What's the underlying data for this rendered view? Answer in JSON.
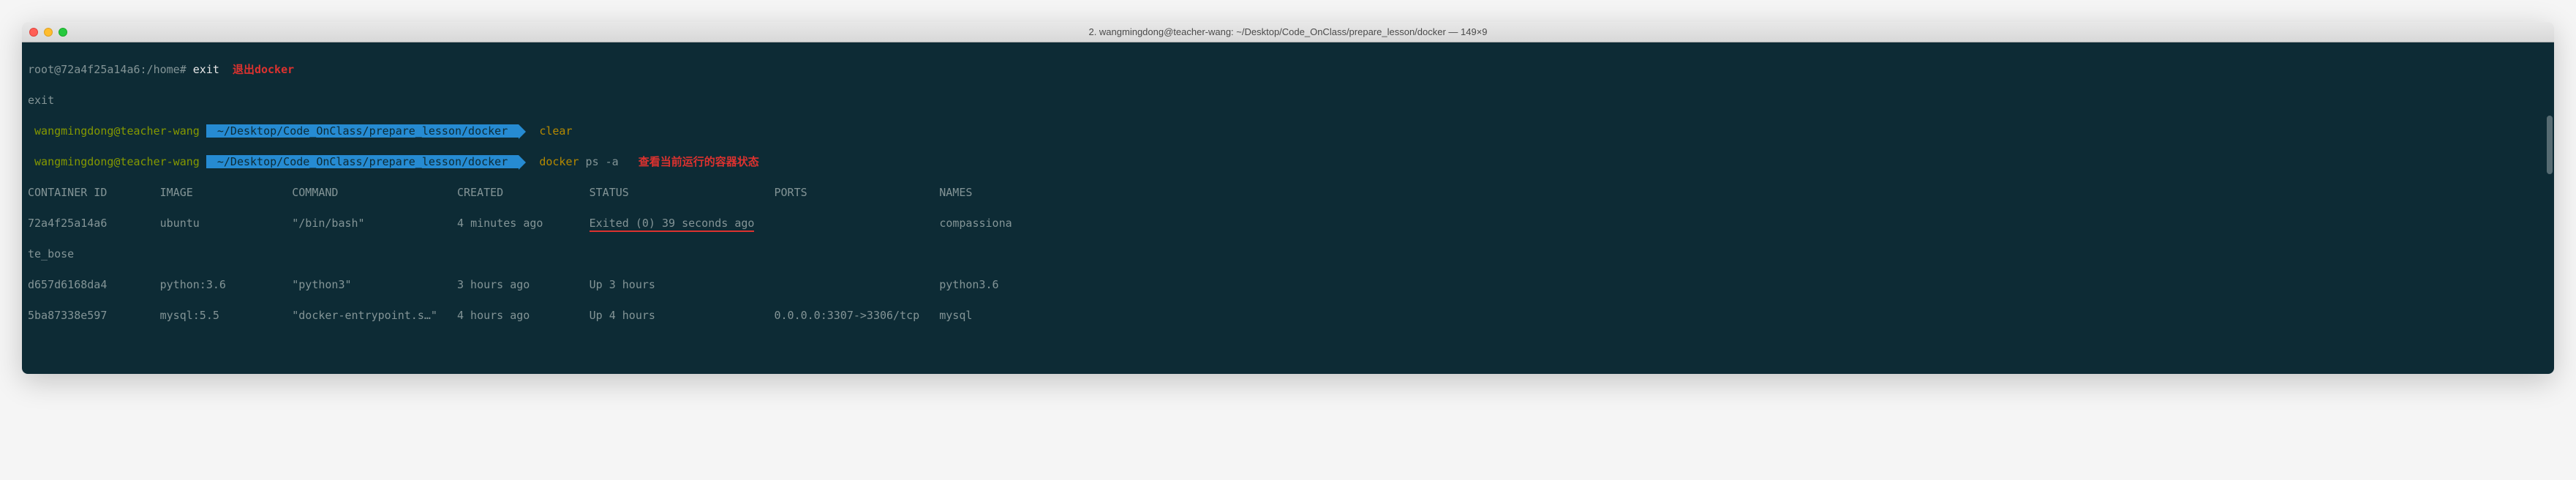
{
  "window": {
    "title": "2. wangmingdong@teacher-wang: ~/Desktop/Code_OnClass/prepare_lesson/docker — 149×9"
  },
  "lines": {
    "l1_prompt": "root@72a4f25a14a6:/home# ",
    "l1_cmd": "exit",
    "l1_anno": "  退出docker",
    "l2": "exit",
    "l3_user": " wangmingdong@teacher-wang ",
    "l3_path": " ~/Desktop/Code_OnClass/prepare_lesson/docker ",
    "l3_cmd": "  clear",
    "l4_user": " wangmingdong@teacher-wang ",
    "l4_path": " ~/Desktop/Code_OnClass/prepare_lesson/docker ",
    "l4_cmd1": "  docker",
    "l4_cmd2": " ps -a",
    "l4_anno": "   查看当前运行的容器状态"
  },
  "table": {
    "headers": {
      "c1": "CONTAINER ID",
      "c2": "IMAGE",
      "c3": "COMMAND",
      "c4": "CREATED",
      "c5": "STATUS",
      "c6": "PORTS",
      "c7": "NAMES"
    },
    "rows": [
      {
        "id": "72a4f25a14a6",
        "image": "ubuntu",
        "command": "\"/bin/bash\"",
        "created": "4 minutes ago",
        "status": "Exited (0) 39 seconds ago",
        "ports": "",
        "names": "compassionate_bose"
      },
      {
        "id": "d657d6168da4",
        "image": "python:3.6",
        "command": "\"python3\"",
        "created": "3 hours ago",
        "status": "Up 3 hours",
        "ports": "",
        "names": "python3.6"
      },
      {
        "id": "5ba87338e597",
        "image": "mysql:5.5",
        "command": "\"docker-entrypoint.s…\"",
        "created": "4 hours ago",
        "status": "Up 4 hours",
        "ports": "0.0.0.0:3307->3306/tcp",
        "names": "mysql"
      }
    ]
  },
  "formatted": {
    "header": "CONTAINER ID        IMAGE               COMMAND                  CREATED             STATUS                      PORTS                    NAMES",
    "row1a_id": "72a4f25a14a6        ",
    "row1a_img": "ubuntu              ",
    "row1a_cmd": "\"/bin/bash\"              ",
    "row1a_cre": "4 minutes ago       ",
    "row1a_sta": "Exited (0) 39 seconds ago",
    "row1a_por": "                            ",
    "row1a_nam": "compassiona",
    "row1b": "te_bose",
    "row2": "d657d6168da4        python:3.6          \"python3\"                3 hours ago         Up 3 hours                                           python3.6",
    "row3": "5ba87338e597        mysql:5.5           \"docker-entrypoint.s…\"   4 hours ago         Up 4 hours                  0.0.0.0:3307->3306/tcp   mysql"
  }
}
